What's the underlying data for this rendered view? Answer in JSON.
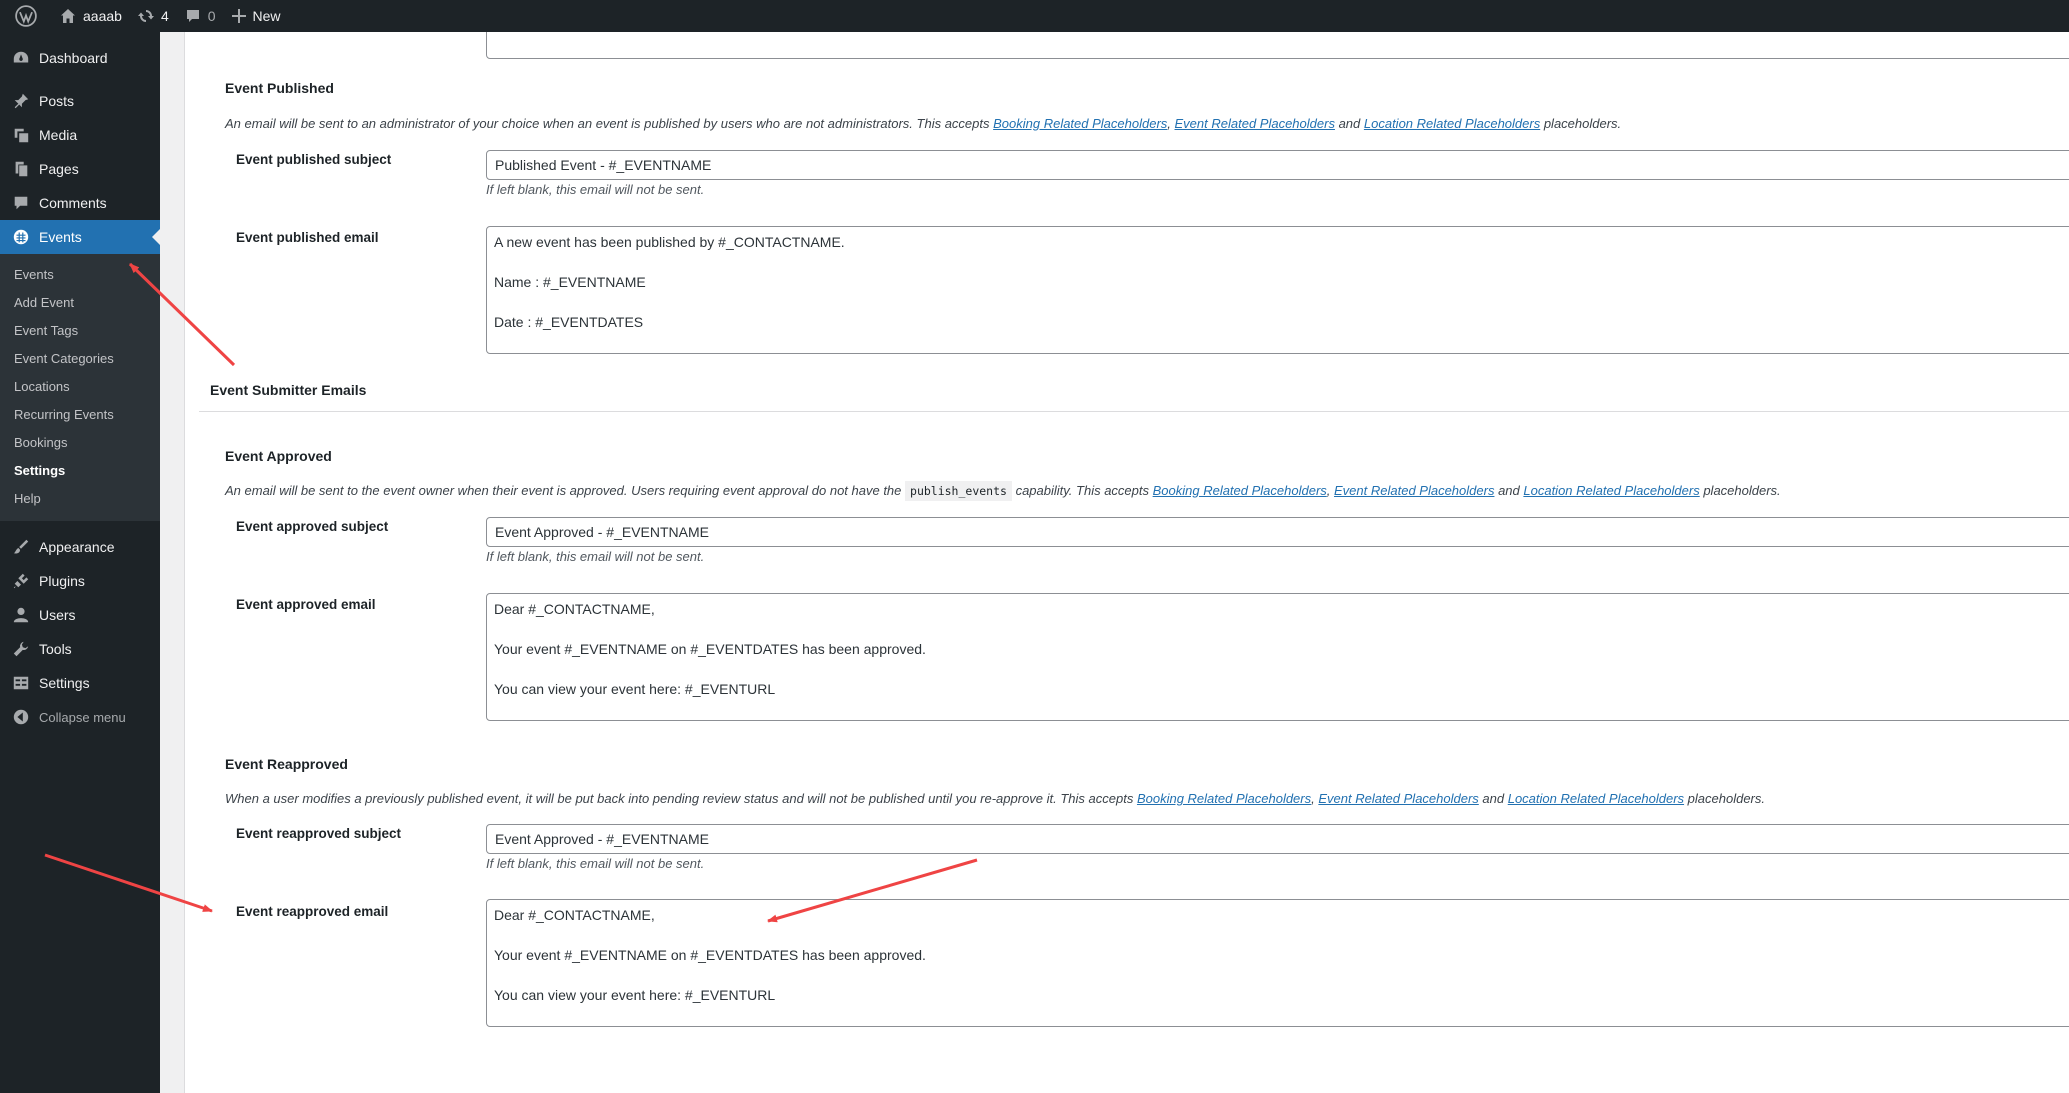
{
  "adminbar": {
    "site_name": "aaaab",
    "updates_count": "4",
    "comments_count": "0",
    "new_label": "New"
  },
  "sidebar": {
    "items_top": [
      {
        "label": "Dashboard",
        "icon": "dashboard-icon"
      },
      {
        "label": "Posts",
        "icon": "pin-icon"
      },
      {
        "label": "Media",
        "icon": "media-icon"
      },
      {
        "label": "Pages",
        "icon": "pages-icon"
      },
      {
        "label": "Comments",
        "icon": "comment-icon"
      },
      {
        "label": "Events",
        "icon": "calendar-icon"
      }
    ],
    "submenu": [
      "Events",
      "Add Event",
      "Event Tags",
      "Event Categories",
      "Locations",
      "Recurring Events",
      "Bookings",
      "Settings",
      "Help"
    ],
    "items_bottom": [
      {
        "label": "Appearance",
        "icon": "brush-icon"
      },
      {
        "label": "Plugins",
        "icon": "plugin-icon"
      },
      {
        "label": "Users",
        "icon": "user-icon"
      },
      {
        "label": "Tools",
        "icon": "wrench-icon"
      },
      {
        "label": "Settings",
        "icon": "settings-icon"
      }
    ],
    "collapse_label": "Collapse menu"
  },
  "links": {
    "booking": "Booking Related Placeholders",
    "event": "Event Related Placeholders",
    "location": "Location Related Placeholders"
  },
  "published": {
    "title": "Event Published",
    "desc_before": "An email will be sent to an administrator of your choice when an event is published by users who are not administrators. This accepts ",
    "sep1": ", ",
    "and": " and ",
    "after": " placeholders.",
    "subject_label": "Event published subject",
    "subject_value": "Published Event - #_EVENTNAME",
    "hint": "If left blank, this email will not be sent.",
    "email_label": "Event published email",
    "email_body": "A new event has been published by #_CONTACTNAME.\n\nName : #_EVENTNAME\n\nDate : #_EVENTDATES"
  },
  "submitter_group_title": "Event Submitter Emails",
  "approved": {
    "title": "Event Approved",
    "desc_before": "An email will be sent to the event owner when their event is approved. Users requiring event approval do not have the ",
    "code": "publish_events",
    "desc_mid": " capability. This accepts ",
    "sep1": ", ",
    "and": " and ",
    "after": " placeholders.",
    "subject_label": "Event approved subject",
    "subject_value": "Event Approved - #_EVENTNAME",
    "hint": "If left blank, this email will not be sent.",
    "email_label": "Event approved email",
    "email_body": "Dear #_CONTACTNAME,\n\nYour event #_EVENTNAME on #_EVENTDATES has been approved.\n\nYou can view your event here: #_EVENTURL"
  },
  "reapproved": {
    "title": "Event Reapproved",
    "desc_before": "When a user modifies a previously published event, it will be put back into pending review status and will not be published until you re-approve it. This accepts ",
    "sep1": ", ",
    "and": " and ",
    "after": " placeholders.",
    "subject_label": "Event reapproved subject",
    "subject_value": "Event Approved - #_EVENTNAME",
    "hint": "If left blank, this email will not be sent.",
    "email_label": "Event reapproved email",
    "email_body": "Dear #_CONTACTNAME,\n\nYour event #_EVENTNAME on #_EVENTDATES has been approved.\n\nYou can view your event here: #_EVENTURL"
  },
  "colors": {
    "adminbar_bg": "#1d2327",
    "menu_current": "#2271b1",
    "link": "#2271b1",
    "annotation_arrow": "#ef4444"
  }
}
